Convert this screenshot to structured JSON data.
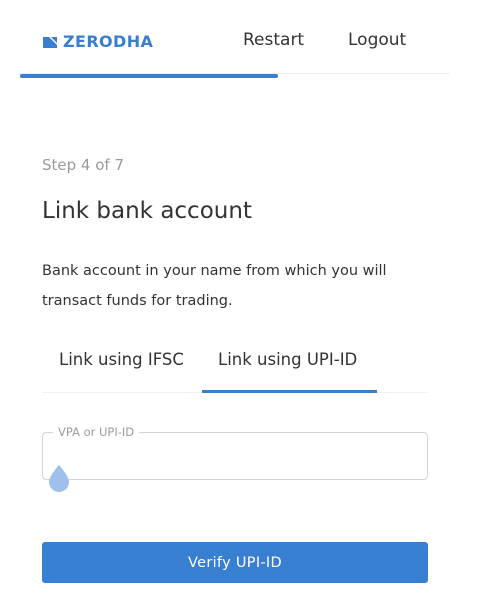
{
  "header": {
    "logo_text": "ZERODHA",
    "restart_label": "Restart",
    "logout_label": "Logout"
  },
  "progress": {
    "fraction": 0.6
  },
  "step": {
    "text": "Step 4 of 7"
  },
  "page": {
    "title": "Link bank account",
    "description": "Bank account in your name from which you will transact funds for trading."
  },
  "tabs": [
    {
      "label": "Link using IFSC",
      "active": false
    },
    {
      "label": "Link using UPI-ID",
      "active": true
    }
  ],
  "upi_field": {
    "label": "VPA or UPI-ID",
    "value": "",
    "placeholder": ""
  },
  "verify_button": {
    "label": "Verify UPI-ID"
  },
  "colors": {
    "brand": "#387ed1",
    "text": "#333333",
    "muted": "#9b9b9b"
  },
  "icons": {
    "logo": "zerodha-logo-icon",
    "cursor": "text-cursor-handle-icon"
  }
}
